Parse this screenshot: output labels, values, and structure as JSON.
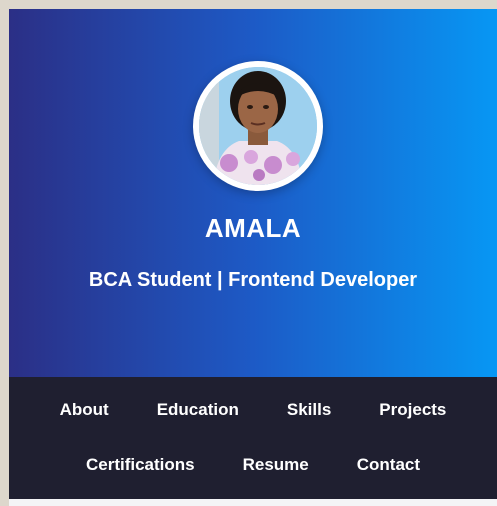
{
  "profile": {
    "name": "AMALA",
    "tagline": "BCA Student | Frontend Developer"
  },
  "nav": {
    "row1": [
      "About",
      "Education",
      "Skills",
      "Projects"
    ],
    "row2": [
      "Certifications",
      "Resume",
      "Contact"
    ]
  },
  "colors": {
    "gradient_start": "#2b2f86",
    "gradient_end": "#0797f4",
    "nav_background": "#1f1f30"
  }
}
